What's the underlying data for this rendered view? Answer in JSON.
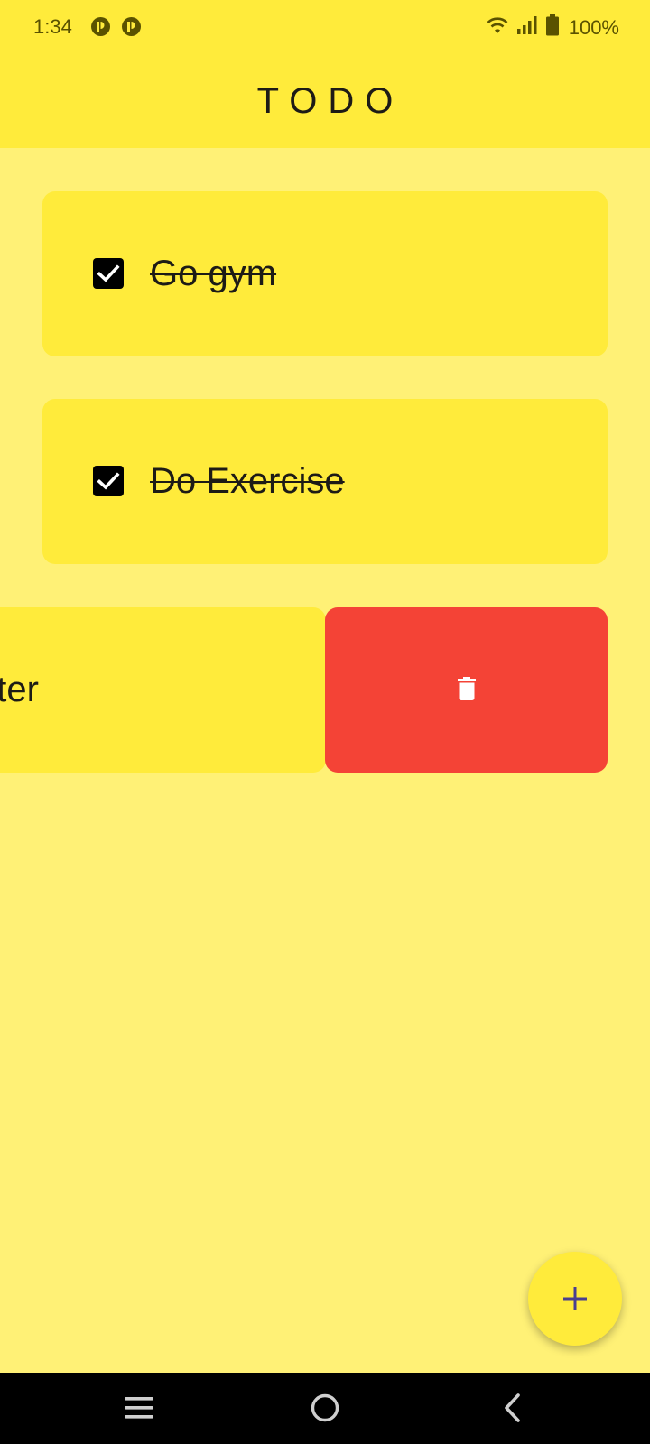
{
  "status_bar": {
    "time": "1:34",
    "battery_text": "100%",
    "icons": [
      "app-notification-icon",
      "app-notification-icon",
      "wifi-icon",
      "cellular-signal-icon",
      "battery-icon"
    ]
  },
  "app_bar": {
    "title": "TODO"
  },
  "todos": [
    {
      "text": "Go gym",
      "checked": true,
      "completed": true
    },
    {
      "text": "Do Exercise",
      "checked": true,
      "completed": true
    },
    {
      "text": "ater",
      "swiped_open": true
    }
  ],
  "swipe_action": {
    "icon": "trash-icon",
    "color": "#F44336"
  },
  "fab": {
    "icon": "plus-icon"
  },
  "nav_bar": {
    "buttons": [
      "recent-apps-icon",
      "home-icon",
      "back-icon"
    ]
  },
  "colors": {
    "background": "#FFF176",
    "app_bar": "#FFEB3B",
    "card": "#FFEB3B",
    "delete": "#F44336",
    "fab_icon": "#4a3f8f"
  }
}
